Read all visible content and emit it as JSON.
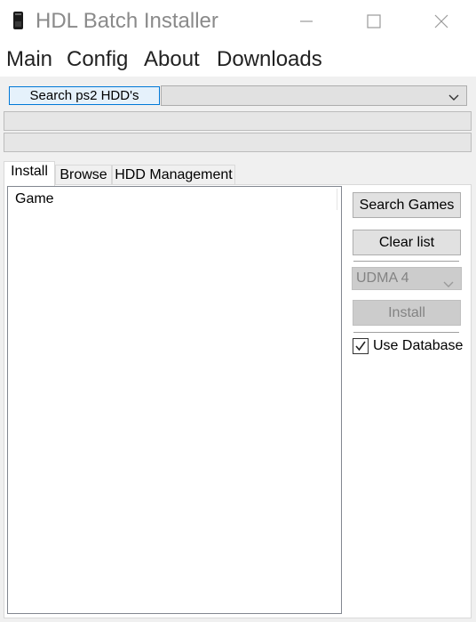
{
  "window": {
    "title": "HDL Batch Installer"
  },
  "menu": {
    "items": [
      "Main",
      "Config",
      "About",
      "Downloads"
    ]
  },
  "toolbar": {
    "search_hdd_label": "Search ps2 HDD's",
    "hdd_select_value": ""
  },
  "tabs": [
    "Install",
    "Browse",
    "HDD Management"
  ],
  "install": {
    "list_header": "Game",
    "search_games_label": "Search Games",
    "clear_list_label": "Clear list",
    "udma_value": "UDMA 4",
    "install_label": "Install",
    "use_database_label": "Use Database",
    "use_database_checked": true
  },
  "colors": {
    "focus_border": "#0078d7",
    "focus_fill": "#e5f1fb",
    "disabled_text": "#838383"
  }
}
